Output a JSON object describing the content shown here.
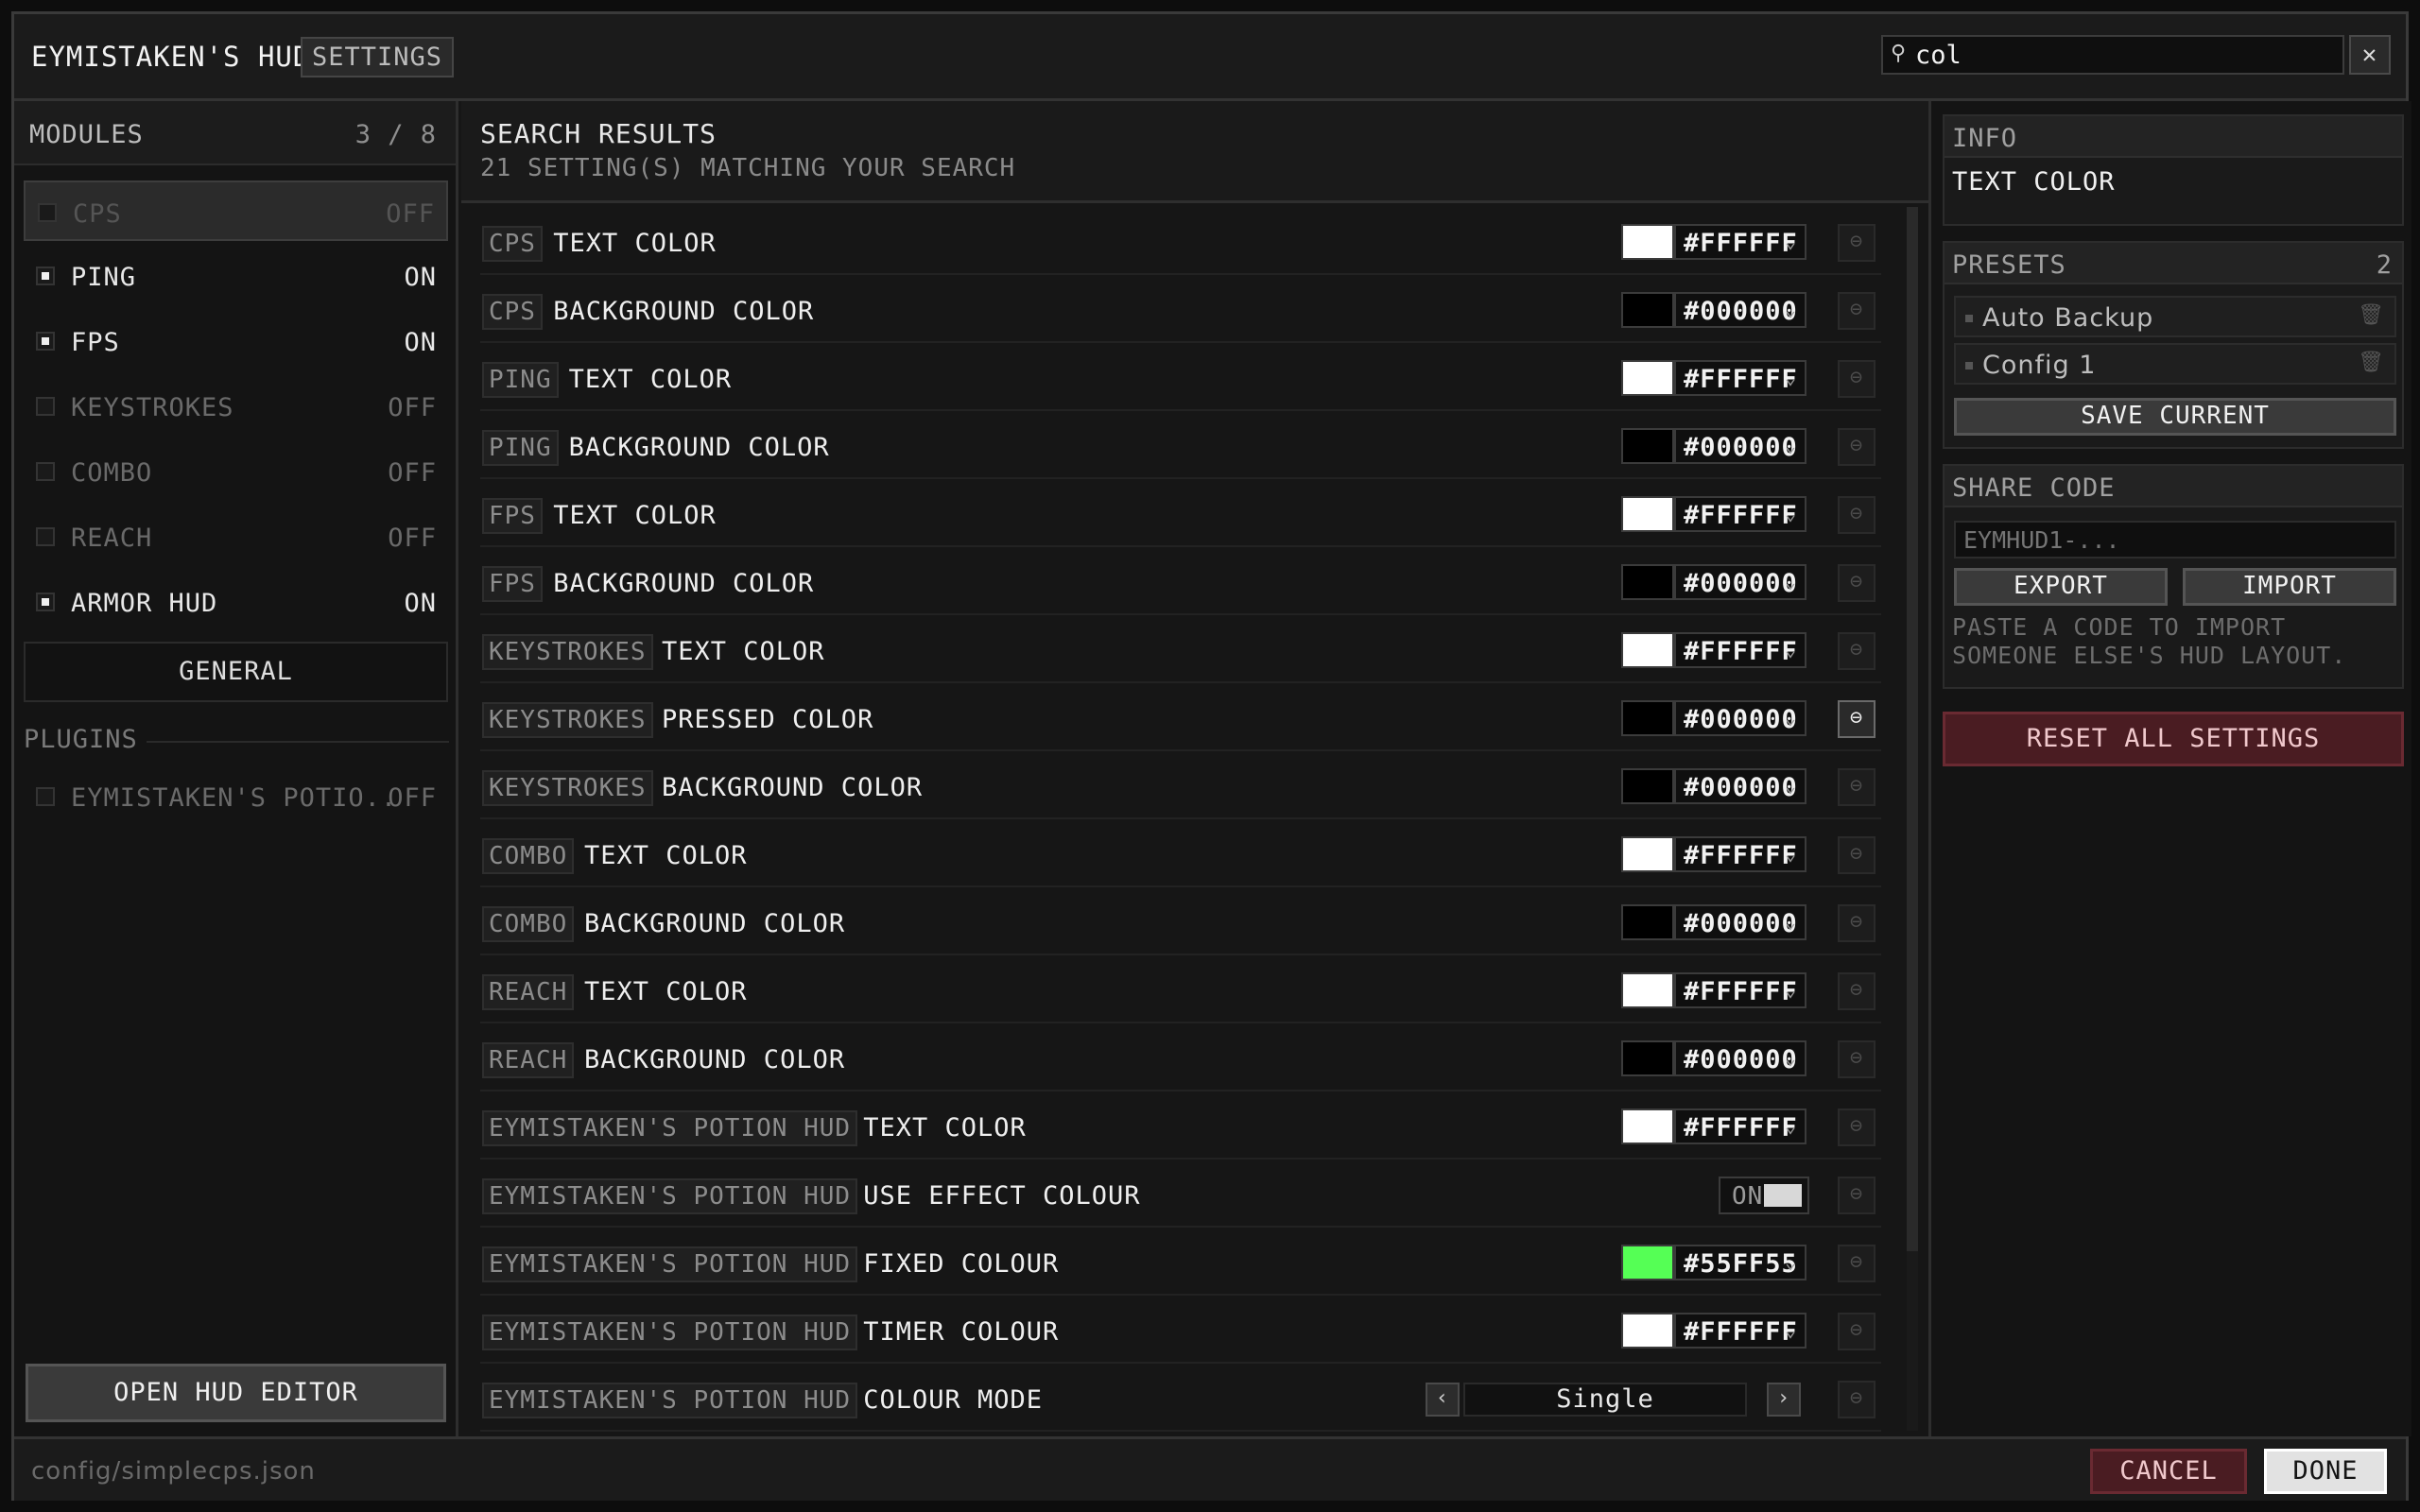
{
  "titlebar": {
    "app_title": "EYMISTAKEN'S HUD",
    "tab": "SETTINGS",
    "search_icon": "search-icon",
    "search_value": "col",
    "close_label": "✕"
  },
  "sidebar": {
    "header": "MODULES",
    "count": "3 / 8",
    "modules": [
      {
        "name": "CPS",
        "state": "OFF"
      },
      {
        "name": "PING",
        "state": "ON"
      },
      {
        "name": "FPS",
        "state": "ON"
      },
      {
        "name": "KEYSTROKES",
        "state": "OFF"
      },
      {
        "name": "COMBO",
        "state": "OFF"
      },
      {
        "name": "REACH",
        "state": "OFF"
      },
      {
        "name": "ARMOR HUD",
        "state": "ON"
      }
    ],
    "general_label": "GENERAL",
    "plugins_label": "PLUGINS",
    "plugins": [
      {
        "name": "EYMISTAKEN'S POTIO..",
        "state": "OFF"
      }
    ],
    "open_editor_label": "OPEN HUD EDITOR"
  },
  "main": {
    "title": "SEARCH RESULTS",
    "subtitle": "21 SETTING(S) MATCHING YOUR SEARCH",
    "rows": [
      {
        "module": "CPS",
        "setting": "TEXT COLOR",
        "hex": "#FFFFFF",
        "color": "#FFFFFF"
      },
      {
        "module": "CPS",
        "setting": "BACKGROUND COLOR",
        "hex": "#000000",
        "color": "#000000"
      },
      {
        "module": "PING",
        "setting": "TEXT COLOR",
        "hex": "#FFFFFF",
        "color": "#FFFFFF"
      },
      {
        "module": "PING",
        "setting": "BACKGROUND COLOR",
        "hex": "#000000",
        "color": "#000000"
      },
      {
        "module": "FPS",
        "setting": "TEXT COLOR",
        "hex": "#FFFFFF",
        "color": "#FFFFFF"
      },
      {
        "module": "FPS",
        "setting": "BACKGROUND COLOR",
        "hex": "#000000",
        "color": "#000000"
      },
      {
        "module": "KEYSTROKES",
        "setting": "TEXT COLOR",
        "hex": "#FFFFFF",
        "color": "#FFFFFF"
      },
      {
        "module": "KEYSTROKES",
        "setting": "PRESSED COLOR",
        "hex": "#000000",
        "color": "#000000"
      },
      {
        "module": "KEYSTROKES",
        "setting": "BACKGROUND COLOR",
        "hex": "#000000",
        "color": "#000000"
      },
      {
        "module": "COMBO",
        "setting": "TEXT COLOR",
        "hex": "#FFFFFF",
        "color": "#FFFFFF"
      },
      {
        "module": "COMBO",
        "setting": "BACKGROUND COLOR",
        "hex": "#000000",
        "color": "#000000"
      },
      {
        "module": "REACH",
        "setting": "TEXT COLOR",
        "hex": "#FFFFFF",
        "color": "#FFFFFF"
      },
      {
        "module": "REACH",
        "setting": "BACKGROUND COLOR",
        "hex": "#000000",
        "color": "#000000"
      },
      {
        "module": "EYMISTAKEN'S POTION HUD",
        "setting": "TEXT COLOR",
        "hex": "#FFFFFF",
        "color": "#FFFFFF"
      },
      {
        "module": "EYMISTAKEN'S POTION HUD",
        "setting": "USE EFFECT COLOUR",
        "toggle": "ON"
      },
      {
        "module": "EYMISTAKEN'S POTION HUD",
        "setting": "FIXED COLOUR",
        "hex": "#55FF55",
        "color": "#55FF55"
      },
      {
        "module": "EYMISTAKEN'S POTION HUD",
        "setting": "TIMER COLOUR",
        "hex": "#FFFFFF",
        "color": "#FFFFFF"
      },
      {
        "module": "EYMISTAKEN'S POTION HUD",
        "setting": "COLOUR MODE",
        "cycle": "Single"
      }
    ],
    "reset_icon": "reset-icon",
    "dropdown_icon": "chevron-down-icon"
  },
  "right": {
    "info_header": "INFO",
    "info_value": "TEXT COLOR",
    "presets_header": "PRESETS",
    "presets_count": "2",
    "presets": [
      "Auto Backup",
      "Config 1"
    ],
    "save_current": "SAVE CURRENT",
    "share_header": "SHARE CODE",
    "share_placeholder": "EYMHUD1-...",
    "export_label": "EXPORT",
    "import_label": "IMPORT",
    "hint": "PASTE A CODE TO IMPORT SOMEONE ELSE'S HUD LAYOUT.",
    "reset_all": "RESET ALL SETTINGS"
  },
  "footer": {
    "path": "config/simplecps.json",
    "cancel": "CANCEL",
    "done": "DONE"
  }
}
